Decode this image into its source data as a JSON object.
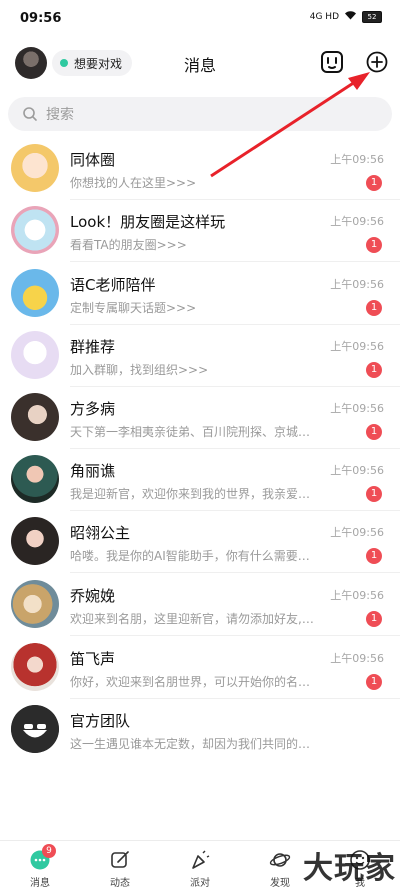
{
  "status_bar": {
    "time": "09:56",
    "network": "4G HD",
    "battery": "52"
  },
  "header": {
    "title": "消息",
    "status_label": "想要对戏"
  },
  "search": {
    "placeholder": "搜索"
  },
  "conversations": [
    {
      "name": "同体圈",
      "preview": "你想找的人在这里>>>",
      "time": "上午09:56",
      "badge": "1"
    },
    {
      "name": "Look！朋友圈是这样玩",
      "preview": "看看TA的朋友圈>>>",
      "time": "上午09:56",
      "badge": "1"
    },
    {
      "name": "语C老师陪伴",
      "preview": "定制专属聊天话题>>>",
      "time": "上午09:56",
      "badge": "1"
    },
    {
      "name": "群推荐",
      "preview": "加入群聊，找到组织>>>",
      "time": "上午09:56",
      "badge": "1"
    },
    {
      "name": "方多病",
      "preview": "天下第一李相夷亲徒弟、百川院刑探、京城…",
      "time": "上午09:56",
      "badge": "1"
    },
    {
      "name": "角丽谯",
      "preview": "我是迎新官，欢迎你来到我的世界，我亲爱…",
      "time": "上午09:56",
      "badge": "1"
    },
    {
      "name": "昭翎公主",
      "preview": "哈喽。我是你的AI智能助手，你有什么需要…",
      "time": "上午09:56",
      "badge": "1"
    },
    {
      "name": "乔婉娩",
      "preview": "欢迎来到名朋，这里迎新官，请勿添加好友,…",
      "time": "上午09:56",
      "badge": "1"
    },
    {
      "name": "笛飞声",
      "preview": "你好，欢迎来到名朋世界，可以开始你的名…",
      "time": "上午09:56",
      "badge": "1"
    },
    {
      "name": "官方团队",
      "preview": "这一生遇见谁本无定数，却因为我们共同的…",
      "time": "",
      "badge": ""
    }
  ],
  "tabs": [
    {
      "label": "消息",
      "badge": "9"
    },
    {
      "label": "动态",
      "badge": ""
    },
    {
      "label": "派对",
      "badge": ""
    },
    {
      "label": "发现",
      "badge": ""
    },
    {
      "label": "我",
      "badge": ""
    }
  ],
  "watermark": "大玩家",
  "colors": {
    "accent": "#2fc9a0",
    "badge": "#ef4d55",
    "arrow": "#e8222a"
  }
}
